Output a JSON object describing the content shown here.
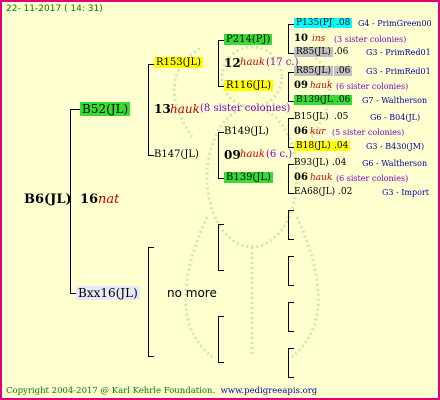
{
  "header": {
    "date": "22- 11-2017 ( 14: 31)"
  },
  "footer": {
    "copyright": "Copyright 2004-2017 @ Karl Kehrle Foundation.",
    "url": "www.pedigreeapis.org"
  },
  "colors": {
    "frame": "#e0007a",
    "background": "#ffffd0",
    "green_box": "#33dd33",
    "yellow_box": "#ffff00",
    "cyan_box": "#00ffff"
  },
  "gen1": {
    "id": "B6(JL)",
    "num": "16",
    "race": "nat"
  },
  "gen2": {
    "top": {
      "id": "B52(JL)"
    },
    "bottom": {
      "id": "Bxx16(JL)",
      "note": "no more"
    }
  },
  "gen3": {
    "group": {
      "num": "13",
      "race": "hauk",
      "sisters": "(8 sister colonies)"
    },
    "top": {
      "id": "R153(JL)"
    },
    "bottom": {
      "id": "B147(JL)"
    }
  },
  "gen4": {
    "a": {
      "id": "P214(PJ)",
      "num": "12",
      "race": "hauk",
      "extra": "(17 c.)"
    },
    "b": {
      "id": "R116(JL)"
    },
    "c": {
      "id": "B149(JL)",
      "num": "09",
      "race": "hauk",
      "extra": "(6 c.)"
    },
    "d": {
      "id": "B139(JL)"
    }
  },
  "gen5": {
    "r1": {
      "id": "P135(PJ)",
      "val": ".08",
      "breeder": "G4 - PrimGreen00"
    },
    "r1s": {
      "num": "10",
      "race": "ins",
      "sisters": "(3 sister colonies)"
    },
    "r2": {
      "id": "R85(JL)",
      "val": ".06",
      "breeder": "G3 - PrimRed01"
    },
    "r3": {
      "id": "R85(JL)",
      "val": ".06",
      "breeder": "G3 - PrimRed01"
    },
    "r3s": {
      "num": "09",
      "race": "hauk",
      "sisters": "(6 sister colonies)"
    },
    "r4": {
      "id": "B139(JL)",
      "val": ".06",
      "breeder": "G7 - Waltherson"
    },
    "r5": {
      "id": "B15(JL)",
      "val": ".05",
      "breeder": "G6 - B04(JL)"
    },
    "r5s": {
      "num": "06",
      "race": "kur",
      "sisters": "(5 sister colonies)"
    },
    "r6": {
      "id": "B18(JL)",
      "val": ".04",
      "breeder": "G3 - B430(JM)"
    },
    "r7": {
      "id": "B93(JL)",
      "val": ".04",
      "breeder": "G6 - Waltherson"
    },
    "r7s": {
      "num": "06",
      "race": "hauk",
      "sisters": "(6 sister colonies)"
    },
    "r8": {
      "id": "EA68(JL)",
      "val": ".02",
      "breeder": "G3 - Import"
    }
  }
}
